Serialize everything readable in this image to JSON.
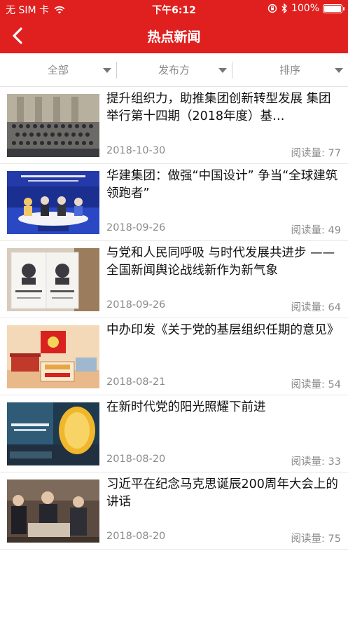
{
  "status_bar": {
    "carrier": "无 SIM 卡",
    "time": "下午6:12",
    "battery": "100%",
    "battery_level": 1.0,
    "icons": [
      "wifi-icon",
      "rotation-lock-icon",
      "bluetooth-icon",
      "battery-icon"
    ]
  },
  "nav": {
    "title": "热点新闻",
    "back_icon": "chevron-left-icon"
  },
  "filters": [
    {
      "label": "全部"
    },
    {
      "label": "发布方"
    },
    {
      "label": "排序"
    }
  ],
  "news": [
    {
      "title": "提升组织力，助推集团创新转型发展 集团举行第十四期（2018年度）基…",
      "date": "2018-10-30",
      "reads": "阅读量: 77"
    },
    {
      "title": "华建集团：做强“中国设计” 争当“全球建筑领跑者”",
      "date": "2018-09-26",
      "reads": "阅读量: 49"
    },
    {
      "title": "与党和人民同呼吸 与时代发展共进步 ——全国新闻舆论战线新作为新气象",
      "date": "2018-09-26",
      "reads": "阅读量: 64"
    },
    {
      "title": "中办印发《关于党的基层组织任期的意见》",
      "date": "2018-08-21",
      "reads": "阅读量: 54"
    },
    {
      "title": "在新时代党的阳光照耀下前进",
      "date": "2018-08-20",
      "reads": "阅读量: 33"
    },
    {
      "title": "习近平在纪念马克思诞辰200周年大会上的讲话",
      "date": "2018-08-20",
      "reads": "阅读量: 75"
    }
  ],
  "colors": {
    "brand_red": "#e0201e",
    "muted_text": "#8a8a8a"
  }
}
